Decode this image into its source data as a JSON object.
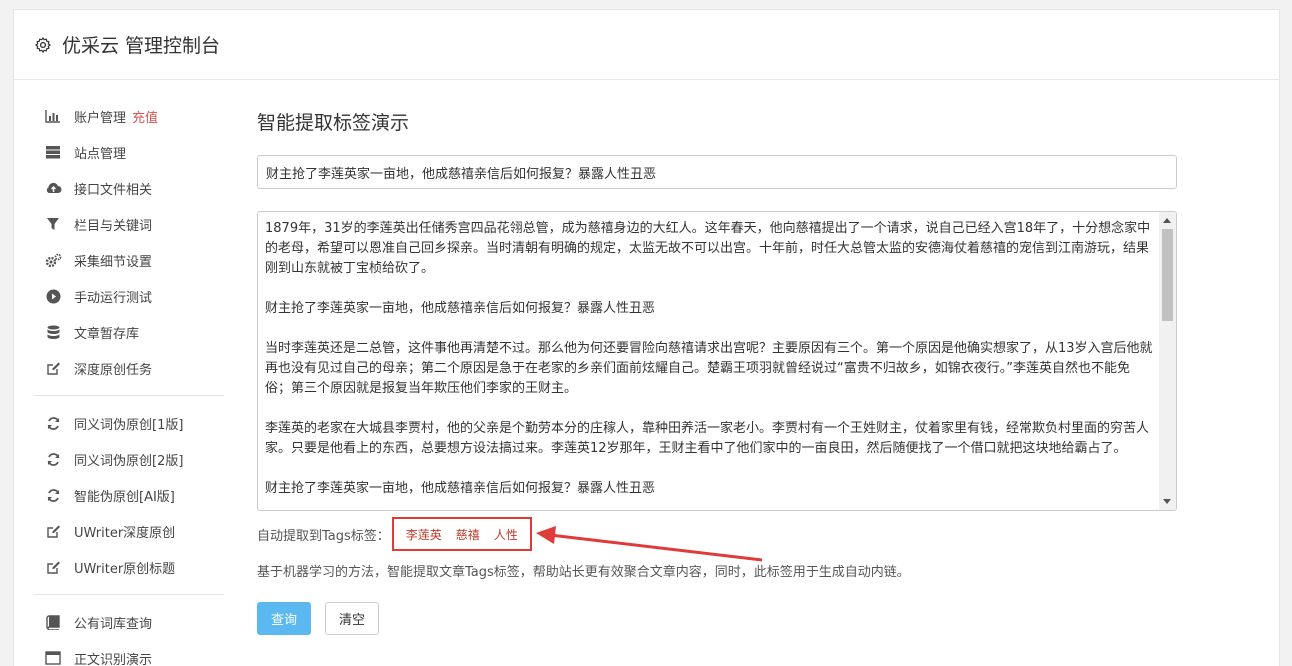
{
  "header": {
    "title": "优采云 管理控制台",
    "icon": "gear-icon"
  },
  "sidebar": {
    "group1": [
      {
        "label": "账户管理",
        "badge": "充值",
        "icon": "bar-chart-icon"
      },
      {
        "label": "站点管理",
        "icon": "server-icon"
      },
      {
        "label": "接口文件相关",
        "icon": "cloud-upload-icon"
      },
      {
        "label": "栏目与关键词",
        "icon": "filter-icon"
      },
      {
        "label": "采集细节设置",
        "icon": "cogs-icon"
      },
      {
        "label": "手动运行测试",
        "icon": "play-icon"
      },
      {
        "label": "文章暂存库",
        "icon": "database-icon"
      },
      {
        "label": "深度原创任务",
        "icon": "edit-icon"
      }
    ],
    "group2": [
      {
        "label": "同义词伪原创[1版]",
        "icon": "refresh-icon"
      },
      {
        "label": "同义词伪原创[2版]",
        "icon": "refresh-icon"
      },
      {
        "label": "智能伪原创[AI版]",
        "icon": "refresh-icon"
      },
      {
        "label": "UWriter深度原创",
        "icon": "edit-icon"
      },
      {
        "label": "UWriter原创标题",
        "icon": "edit-icon"
      }
    ],
    "group3": [
      {
        "label": "公有词库查询",
        "icon": "book-icon"
      },
      {
        "label": "正文识别演示",
        "icon": "window-icon"
      }
    ]
  },
  "main": {
    "page_title": "智能提取标签演示",
    "title_value": "财主抢了李莲英家一亩地，他成慈禧亲信后如何报复？暴露人性丑恶",
    "content_paragraphs": [
      "1879年，31岁的李莲英出任储秀宫四品花翎总管，成为慈禧身边的大红人。这年春天，他向慈禧提出了一个请求，说自己已经入宫18年了，十分想念家中的老母，希望可以恩准自己回乡探亲。当时清朝有明确的规定，太监无故不可以出宫。十年前，时任大总管太监的安德海仗着慈禧的宠信到江南游玩，结果刚到山东就被丁宝桢给砍了。",
      "财主抢了李莲英家一亩地，他成慈禧亲信后如何报复？暴露人性丑恶",
      "当时李莲英还是二总管，这件事他再清楚不过。那么他为何还要冒险向慈禧请求出宫呢？主要原因有三个。第一个原因是他确实想家了，从13岁入宫后他就再也没有见过自己的母亲；第二个原因是急于在老家的乡亲们面前炫耀自己。楚霸王项羽就曾经说过“富贵不归故乡，如锦衣夜行。”李莲英自然也不能免俗；第三个原因就是报复当年欺压他们李家的王财主。",
      "李莲英的老家在大城县李贾村，他的父亲是个勤劳本分的庄稼人，靠种田养活一家老小。李贾村有一个王姓财主，仗着家里有钱，经常欺负村里面的穷苦人家。只要是他看上的东西，总要想方设法搞过来。李莲英12岁那年，王财主看中了他们家中的一亩良田，然后随便找了一个借口就把这块地给霸占了。",
      "财主抢了李莲英家一亩地，他成慈禧亲信后如何报复？暴露人性丑恶"
    ],
    "tags_label": "自动提取到Tags标签：",
    "tags": [
      "李莲英",
      "慈禧",
      "人性"
    ],
    "description": "基于机器学习的方法，智能提取文章Tags标签，帮助站长更有效聚合文章内容，同时，此标签用于生成自动内链。",
    "query_button": "查询",
    "clear_button": "清空"
  },
  "colors": {
    "accent": "#5bb8f0",
    "badge": "#d9534f",
    "highlight": "#e03b3b",
    "tag_text": "#c0392b"
  }
}
